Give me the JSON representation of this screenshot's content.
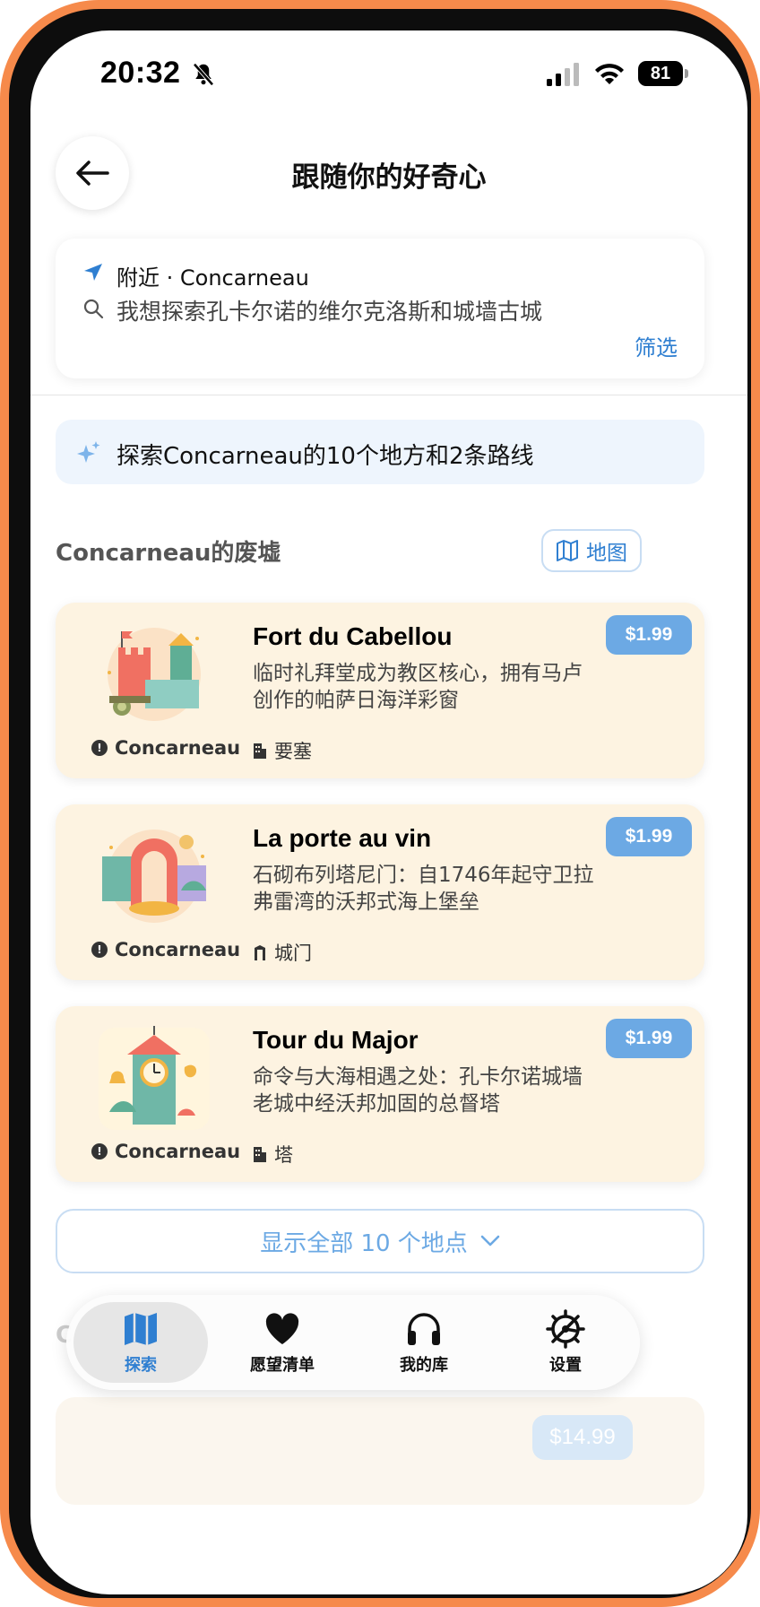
{
  "status_bar": {
    "time": "20:32",
    "battery": "81"
  },
  "header": {
    "title": "跟随你的好奇心"
  },
  "search": {
    "location": "附近 · Concarneau",
    "query": "我想探索孔卡尔诺的维尔克洛斯和城墙古城",
    "filter_label": "筛选"
  },
  "banner": {
    "text": "探索Concarneau的10个地方和2条路线"
  },
  "section": {
    "title": "Concarneau的废墟",
    "map_label": "地图"
  },
  "places": [
    {
      "name": "Fort du Cabellou",
      "desc": "临时礼拜堂成为教区核心，拥有马卢创作的帕萨日海洋彩窗",
      "city": "Concarneau",
      "type": "要塞",
      "price": "$1.99"
    },
    {
      "name": "La porte au vin",
      "desc": "石砌布列塔尼门：自1746年起守卫拉弗雷湾的沃邦式海上堡垒",
      "city": "Concarneau",
      "type": "城门",
      "price": "$1.99"
    },
    {
      "name": "Tour du Major",
      "desc": "命令与大海相遇之处：孔卡尔诺城墙老城中经沃邦加固的总督塔",
      "city": "Concarneau",
      "type": "塔",
      "price": "$1.99"
    }
  ],
  "show_all": {
    "label": "显示全部 10 个地点"
  },
  "hidden": {
    "heading": "C",
    "price": "$14.99"
  },
  "tabs": [
    {
      "label": "探索",
      "icon": "map-icon",
      "active": true
    },
    {
      "label": "愿望清单",
      "icon": "heart-icon",
      "active": false
    },
    {
      "label": "我的库",
      "icon": "headphones-icon",
      "active": false
    },
    {
      "label": "设置",
      "icon": "gear-icon",
      "active": false
    }
  ],
  "colors": {
    "accent": "#2F7FD1",
    "price_badge": "#6CA9E4",
    "card_bg": "#FDF3E1",
    "frame": "#F68A4B"
  }
}
